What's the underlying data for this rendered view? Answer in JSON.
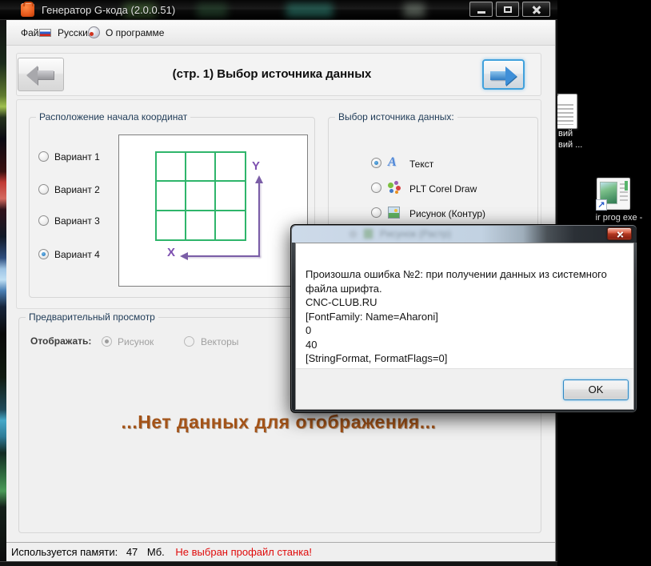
{
  "window": {
    "title": "Генератор G-кода (2.0.0.51)"
  },
  "menu": {
    "file": "Файл",
    "language": "Русский",
    "about": "О программе"
  },
  "nav": {
    "title": "(стр. 1) Выбор источника данных"
  },
  "origin_group": {
    "title": "Расположение начала координат",
    "options": [
      {
        "label": "Вариант 1",
        "selected": false
      },
      {
        "label": "Вариант 2",
        "selected": false
      },
      {
        "label": "Вариант 3",
        "selected": false
      },
      {
        "label": "Вариант 4",
        "selected": true
      }
    ],
    "axis": {
      "x": "X",
      "y": "Y"
    }
  },
  "source_group": {
    "title": "Выбор источника данных:",
    "options": [
      {
        "label": "Текст",
        "selected": true,
        "icon": "text-icon"
      },
      {
        "label": "PLT Corel Draw",
        "selected": false,
        "icon": "plt-icon"
      },
      {
        "label": "Рисунок (Контур)",
        "selected": false,
        "icon": "picture-icon"
      },
      {
        "label": "Рисунок (Растр)",
        "selected": false,
        "icon": "picture-icon",
        "obscured_by_dialog": true
      }
    ]
  },
  "preview_group": {
    "title": "Предварительный просмотр",
    "display_label": "Отображать:",
    "options": [
      {
        "label": "Рисунок",
        "selected": true,
        "disabled": true
      },
      {
        "label": "Векторы",
        "selected": false,
        "disabled": true
      }
    ],
    "no_data_message": "...Нет данных для отображения..."
  },
  "status_bar": {
    "memory_label": "Используется памяти:",
    "memory_value": "47",
    "memory_unit": "Мб.",
    "warning": "Не выбран профайл станка!"
  },
  "error_dialog": {
    "lines": [
      "Произошла ошибка №2: при получении данных из системного файла шрифта.",
      "CNC-CLUB.RU",
      "[FontFamily: Name=Aharoni]",
      "0",
      "40",
      "[StringFormat, FormatFlags=0]"
    ],
    "ok_label": "OK"
  },
  "desktop": {
    "doc_label_line1": "вий",
    "doc_label_line2": "вий ...",
    "shortcut_label": "ir prog exe -",
    "shortcut_arrow_glyph": "↗"
  },
  "colors": {
    "accent_blue": "#3C97D3",
    "grid_green": "#2FB56B",
    "axis_purple": "#7B5EA7",
    "warning_red": "#E00B0B",
    "message_orange": "#A35318",
    "close_button_red": "#B23A22"
  }
}
